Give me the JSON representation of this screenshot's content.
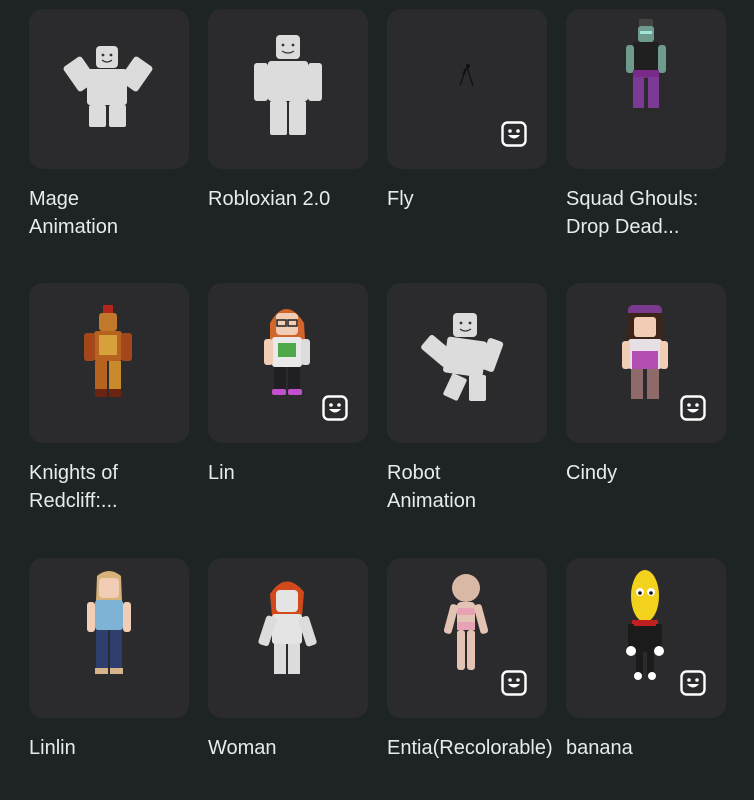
{
  "items": [
    {
      "name": "Mage\nAnimation",
      "emote": false
    },
    {
      "name": "Robloxian 2.0",
      "emote": false
    },
    {
      "name": "Fly",
      "emote": true
    },
    {
      "name": "Squad Ghouls:\nDrop Dead...",
      "emote": false
    },
    {
      "name": "Knights of\nRedcliff:...",
      "emote": false
    },
    {
      "name": "Lin",
      "emote": true
    },
    {
      "name": "Robot\nAnimation",
      "emote": false
    },
    {
      "name": "Cindy",
      "emote": true
    },
    {
      "name": "Linlin",
      "emote": false
    },
    {
      "name": "Woman",
      "emote": false
    },
    {
      "name": "Entia(Recolorable)",
      "emote": true
    },
    {
      "name": "banana",
      "emote": true
    }
  ],
  "icons": {
    "emote_badge": "emote-smiley-icon"
  },
  "colors": {
    "background": "#1e2425",
    "card": "#2b2b2d",
    "text": "#e8eaeb"
  }
}
